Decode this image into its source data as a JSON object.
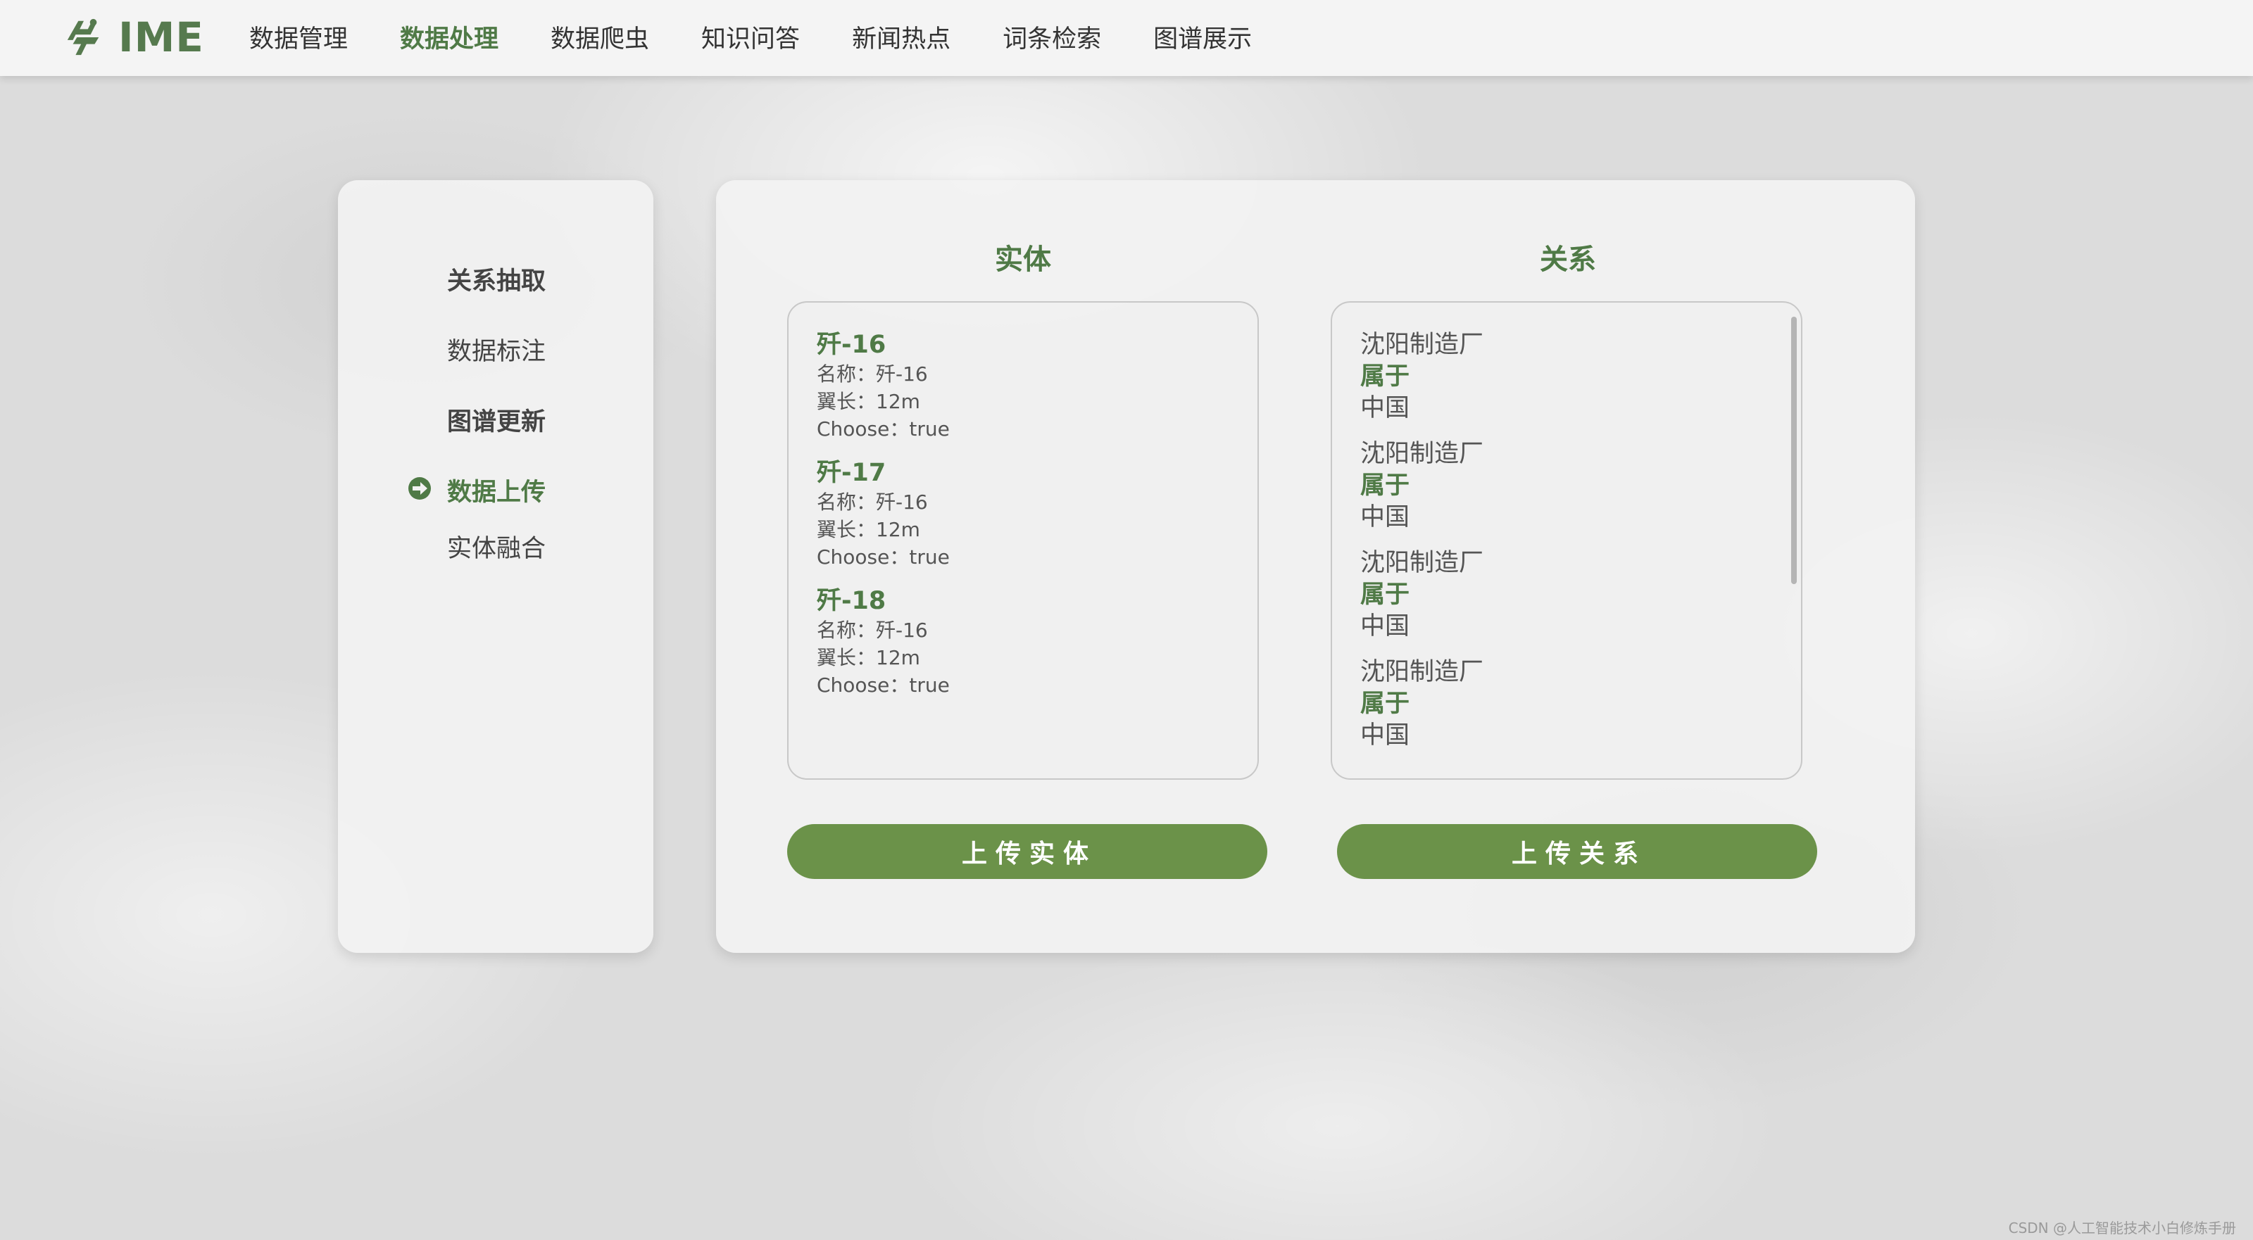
{
  "brand": {
    "name": "IME",
    "icon": "ime-logo-icon"
  },
  "nav": {
    "items": [
      "数据管理",
      "数据处理",
      "数据爬虫",
      "知识问答",
      "新闻热点",
      "词条检索",
      "图谱展示"
    ],
    "active_index": 1
  },
  "sidebar": {
    "items": [
      "关系抽取",
      "数据标注",
      "图谱更新",
      "数据上传",
      "实体融合"
    ],
    "active_index": 3,
    "active_icon": "arrow-right-icon"
  },
  "entities": {
    "title": "实体",
    "items": [
      {
        "name": "歼-16",
        "attrs": [
          "名称：歼-16",
          "翼长：12m",
          "Choose：true"
        ]
      },
      {
        "name": "歼-17",
        "attrs": [
          "名称：歼-16",
          "翼长：12m",
          "Choose：true"
        ]
      },
      {
        "name": "歼-18",
        "attrs": [
          "名称：歼-16",
          "翼长：12m",
          "Choose：true"
        ]
      }
    ],
    "button_label": "上传实体"
  },
  "relations": {
    "title": "关系",
    "items": [
      {
        "subject": "沈阳制造厂",
        "predicate": "属于",
        "object": "中国"
      },
      {
        "subject": "沈阳制造厂",
        "predicate": "属于",
        "object": "中国"
      },
      {
        "subject": "沈阳制造厂",
        "predicate": "属于",
        "object": "中国"
      },
      {
        "subject": "沈阳制造厂",
        "predicate": "属于",
        "object": "中国"
      }
    ],
    "button_label": "上传关系"
  },
  "watermark": "CSDN @人工智能技术小白修炼手册",
  "colors": {
    "accent": "#4f7a46",
    "button": "#6b9249"
  }
}
